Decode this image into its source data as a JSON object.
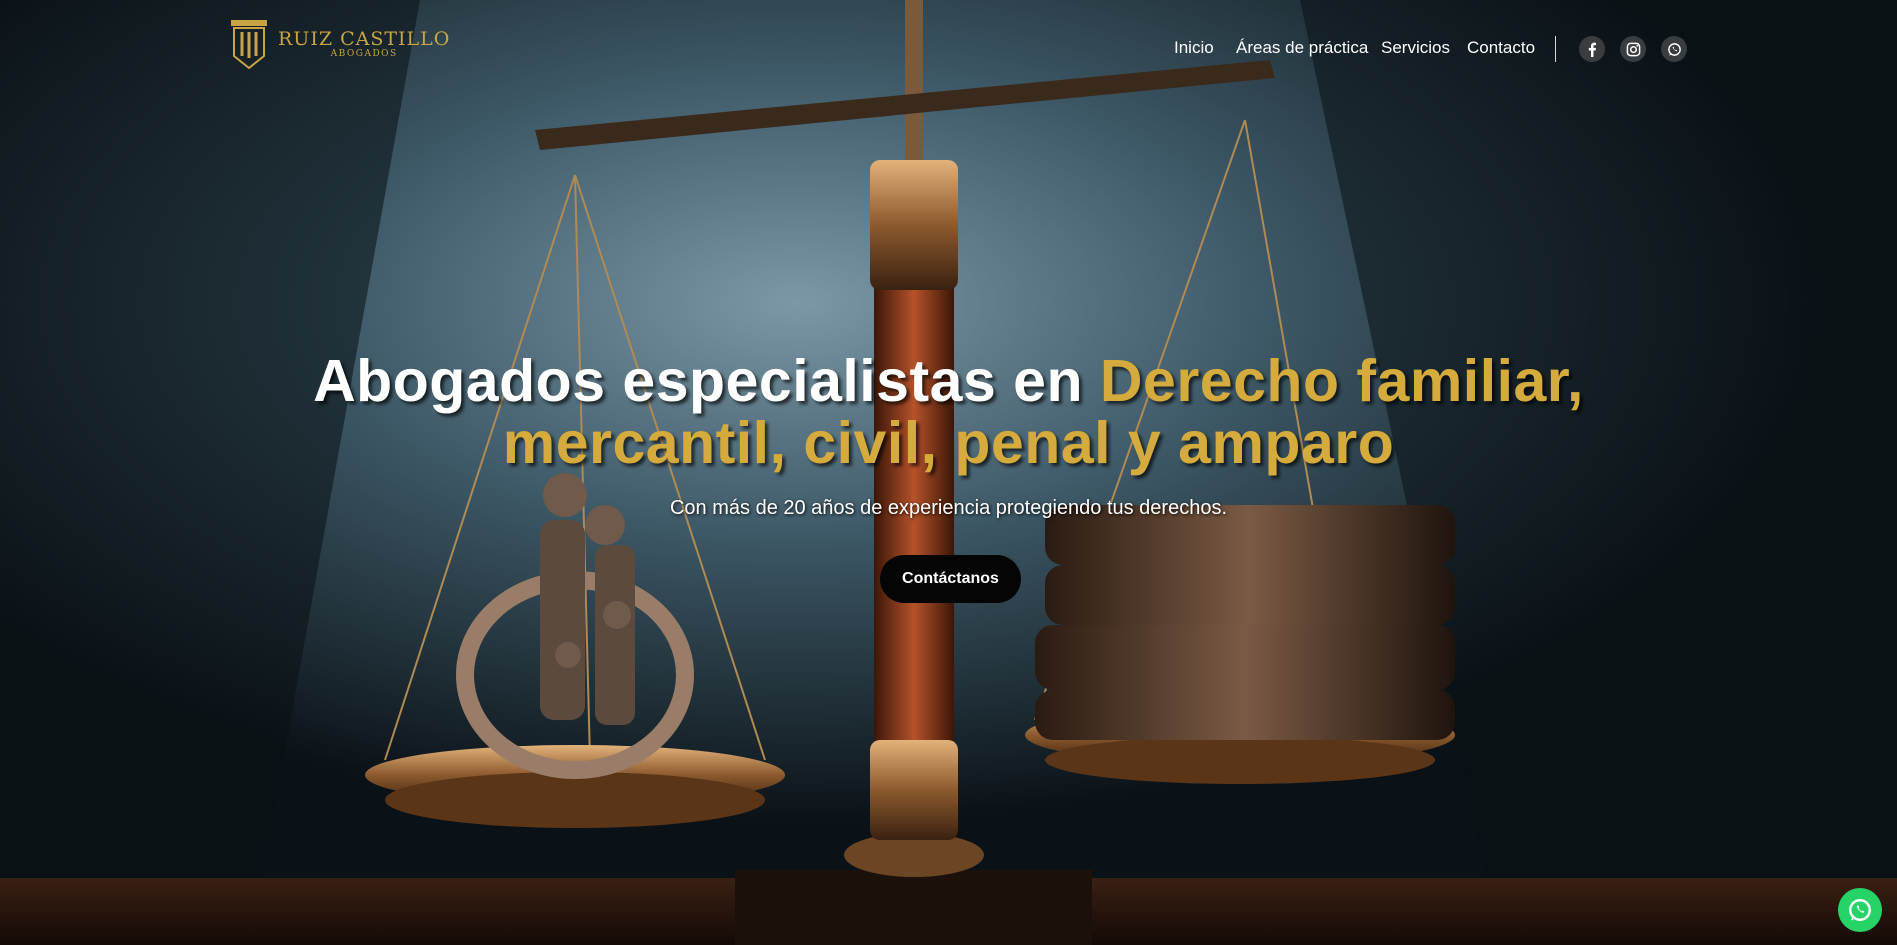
{
  "brand": {
    "name": "RUIZ CASTILLO",
    "subtitle": "ABOGADOS",
    "accent_color": "#c9a445"
  },
  "nav": {
    "items": [
      {
        "label": "Inicio"
      },
      {
        "label": "Áreas de práctica"
      },
      {
        "label": "Servicios"
      },
      {
        "label": "Contacto"
      }
    ],
    "social": [
      "facebook-icon",
      "instagram-icon",
      "whatsapp-icon"
    ]
  },
  "hero": {
    "headline_white": "Abogados especialistas en ",
    "headline_gold_1": "Derecho familiar,",
    "headline_gold_2": "mercantil, civil, penal y amparo",
    "subtitle": "Con más de 20 años de experiencia protegiendo tus derechos.",
    "cta_label": "Contáctanos",
    "headline_gold_color": "#d4ab3c"
  },
  "floating": {
    "whatsapp_color": "#25d366",
    "icon": "whatsapp-icon"
  }
}
